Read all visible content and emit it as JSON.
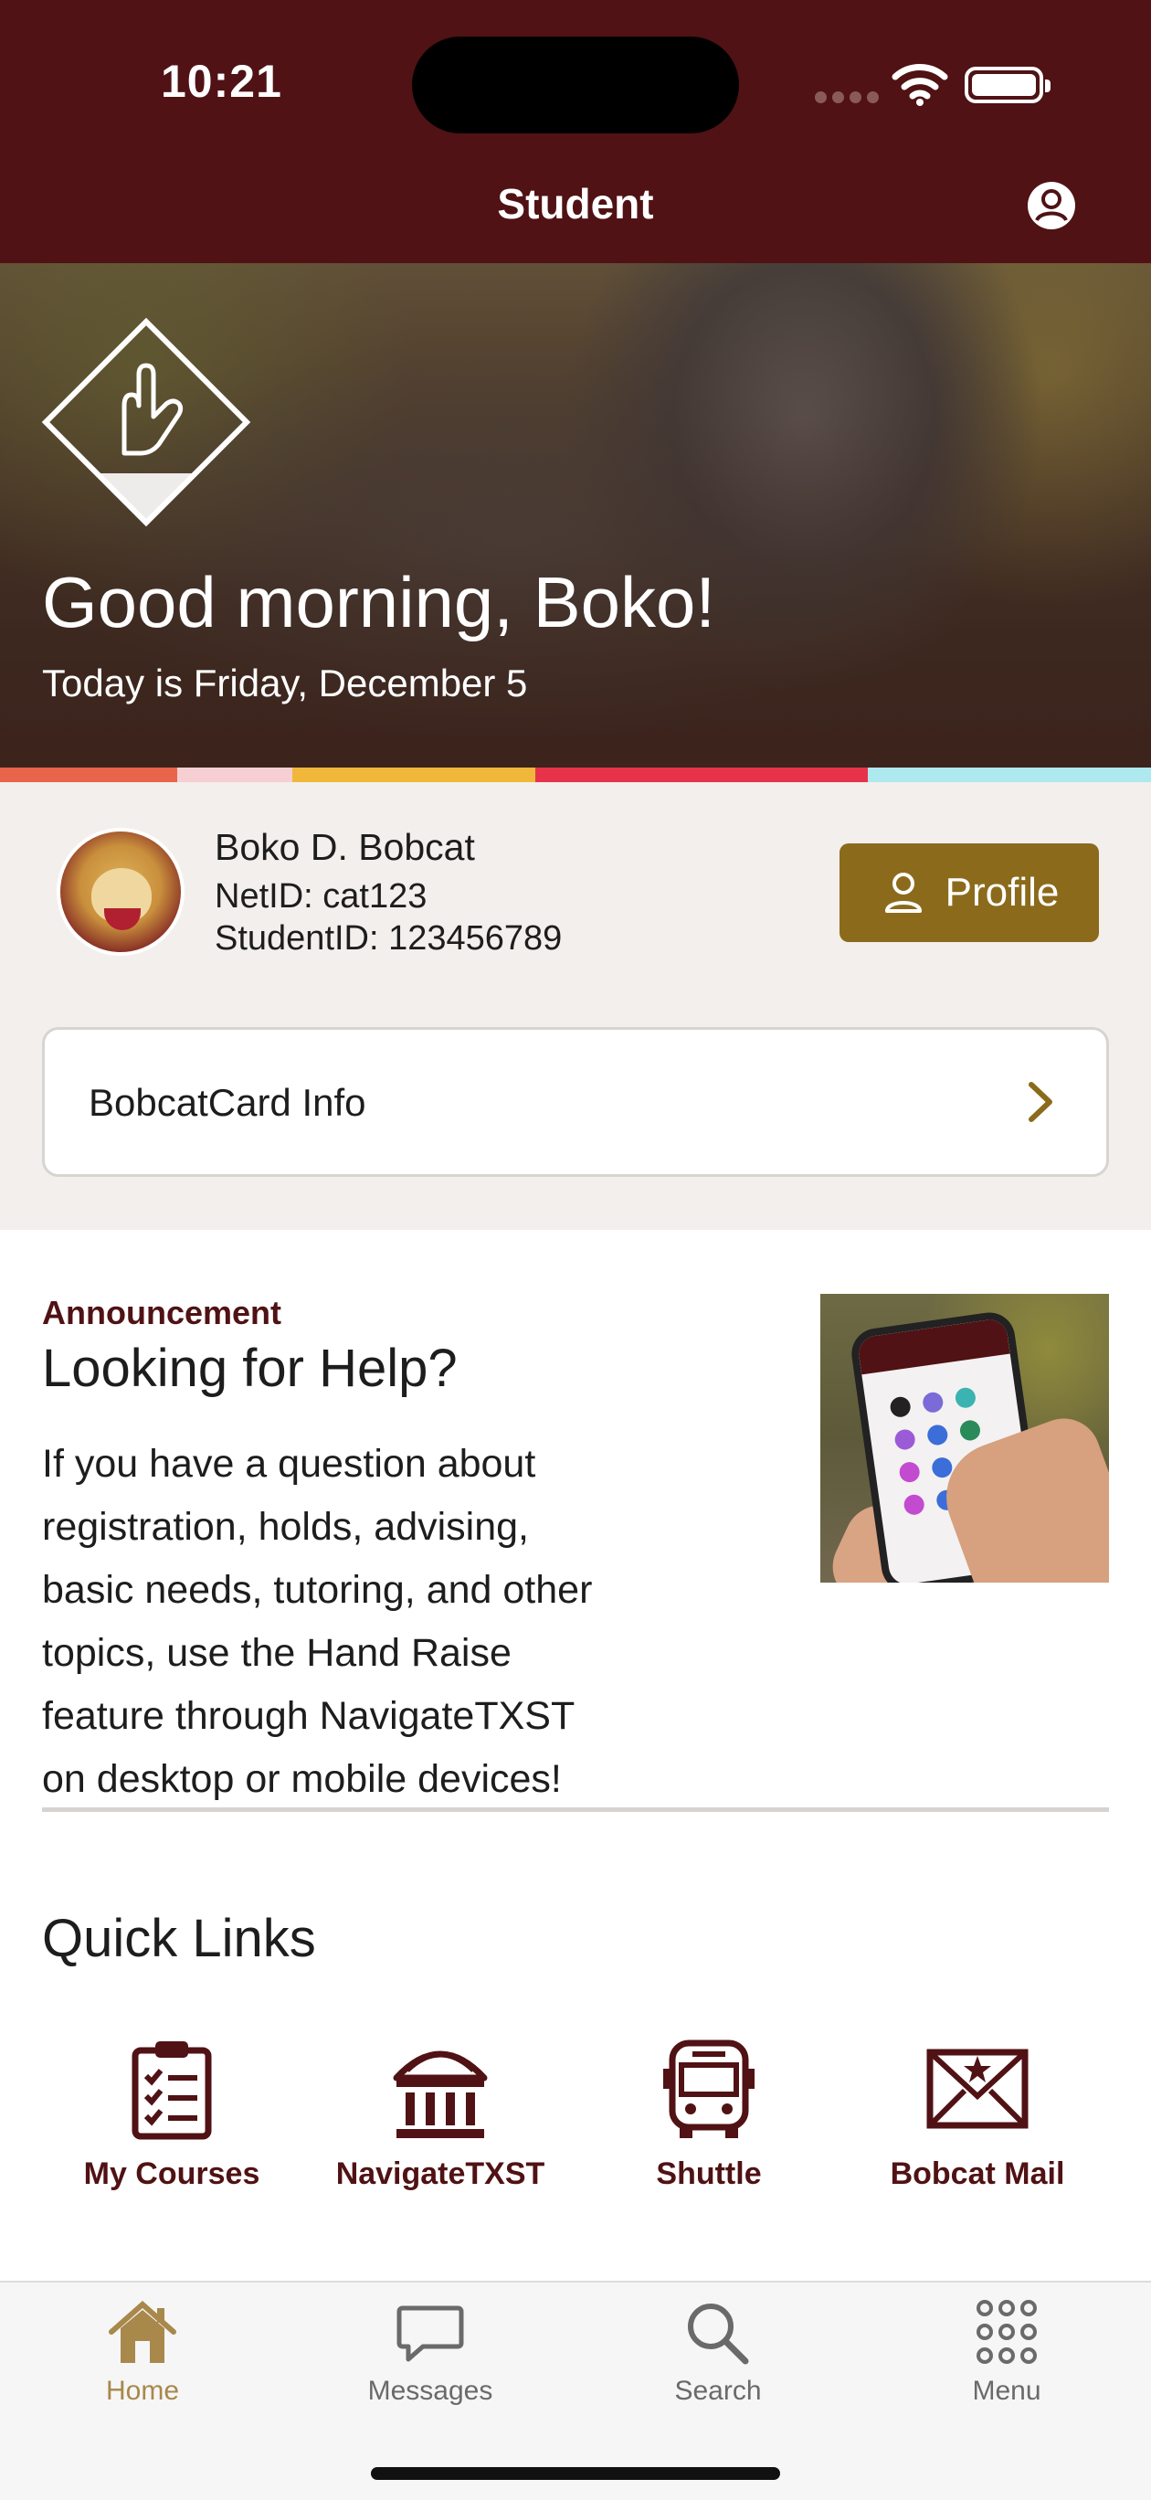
{
  "status_bar": {
    "time": "10:21"
  },
  "nav": {
    "title": "Student",
    "account_icon": "person-circle-icon"
  },
  "hero": {
    "greeting": "Good morning, Boko!",
    "date": "Today is Friday, December 5",
    "logo_icon": "hand-sign-diamond-icon"
  },
  "stripe_colors": [
    "#e8644a",
    "#f6cfd3",
    "#f0b73a",
    "#e7334a",
    "#aee9ef"
  ],
  "user": {
    "name": "Boko D. Bobcat",
    "netid": "NetID: cat123",
    "studentid": "StudentID: 123456789",
    "profile_button": "Profile"
  },
  "bobcat_card": {
    "label": "BobcatCard Info"
  },
  "announcement": {
    "kicker": "Announcement",
    "title": "Looking for Help?",
    "body": "If you have a question about registration, holds, advising, basic needs, tutoring, and other topics, use the Hand Raise feature through NavigateTXST on desktop or mobile devices!"
  },
  "quick_links": {
    "title": "Quick Links",
    "items": [
      {
        "label": "My Courses",
        "icon": "clipboard-checklist-icon"
      },
      {
        "label": "NavigateTXST",
        "icon": "institution-icon"
      },
      {
        "label": "Shuttle",
        "icon": "bus-icon"
      },
      {
        "label": "Bobcat Mail",
        "icon": "envelope-star-icon"
      }
    ]
  },
  "tabs": [
    {
      "label": "Home",
      "icon": "home-icon",
      "active": true
    },
    {
      "label": "Messages",
      "icon": "chat-bubble-icon",
      "active": false
    },
    {
      "label": "Search",
      "icon": "search-icon",
      "active": false
    },
    {
      "label": "Menu",
      "icon": "grid-dots-icon",
      "active": false
    }
  ],
  "colors": {
    "maroon": "#501214",
    "gold": "#8b6b1b",
    "tab_active": "#a8884b"
  }
}
